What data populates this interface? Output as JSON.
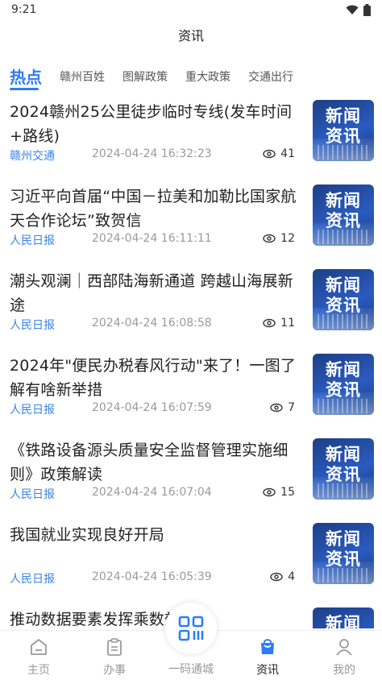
{
  "status_bar": {
    "time": "9:21"
  },
  "header": {
    "title": "资讯"
  },
  "tabs": [
    {
      "label": "热点",
      "active": true
    },
    {
      "label": "赣州百姓",
      "active": false
    },
    {
      "label": "图解政策",
      "active": false
    },
    {
      "label": "重大政策",
      "active": false
    },
    {
      "label": "交通出行",
      "active": false
    }
  ],
  "news": [
    {
      "title": "2024赣州25公里徒步临时专线(发车时间+路线)",
      "source": "赣州交通",
      "time": "2024-04-24 16:32:23",
      "views": "41",
      "thumb_text": "新闻资讯"
    },
    {
      "title": "习近平向首届“中国－拉美和加勒比国家航天合作论坛”致贺信",
      "source": "人民日报",
      "time": "2024-04-24 16:11:11",
      "views": "12",
      "thumb_text": "新闻资讯"
    },
    {
      "title": "潮头观澜｜西部陆海新通道 跨越山海展新途",
      "source": "人民日报",
      "time": "2024-04-24 16:08:58",
      "views": "11",
      "thumb_text": "新闻资讯"
    },
    {
      "title": "2024年\"便民办税春风行动\"来了！一图了解有啥新举措",
      "source": "人民日报",
      "time": "2024-04-24 16:07:59",
      "views": "7",
      "thumb_text": "新闻资讯"
    },
    {
      "title": "《铁路设备源头质量安全监督管理实施细则》政策解读",
      "source": "人民日报",
      "time": "2024-04-24 16:07:04",
      "views": "15",
      "thumb_text": "新闻资讯"
    },
    {
      "title": "我国就业实现良好开局",
      "source": "人民日报",
      "time": "2024-04-24 16:05:39",
      "views": "4",
      "thumb_text": "新闻资讯"
    },
    {
      "title": "推动数据要素发挥乘数效应",
      "source": "",
      "time": "",
      "views": "",
      "thumb_text": "新闻"
    }
  ],
  "bottom_nav": {
    "home": "主页",
    "affairs": "办事",
    "scan": "一码通城",
    "news": "资讯",
    "mine": "我的"
  },
  "colors": {
    "accent": "#2d7cf6",
    "source": "#3a84e6",
    "thumb": "#2a5bc0"
  }
}
